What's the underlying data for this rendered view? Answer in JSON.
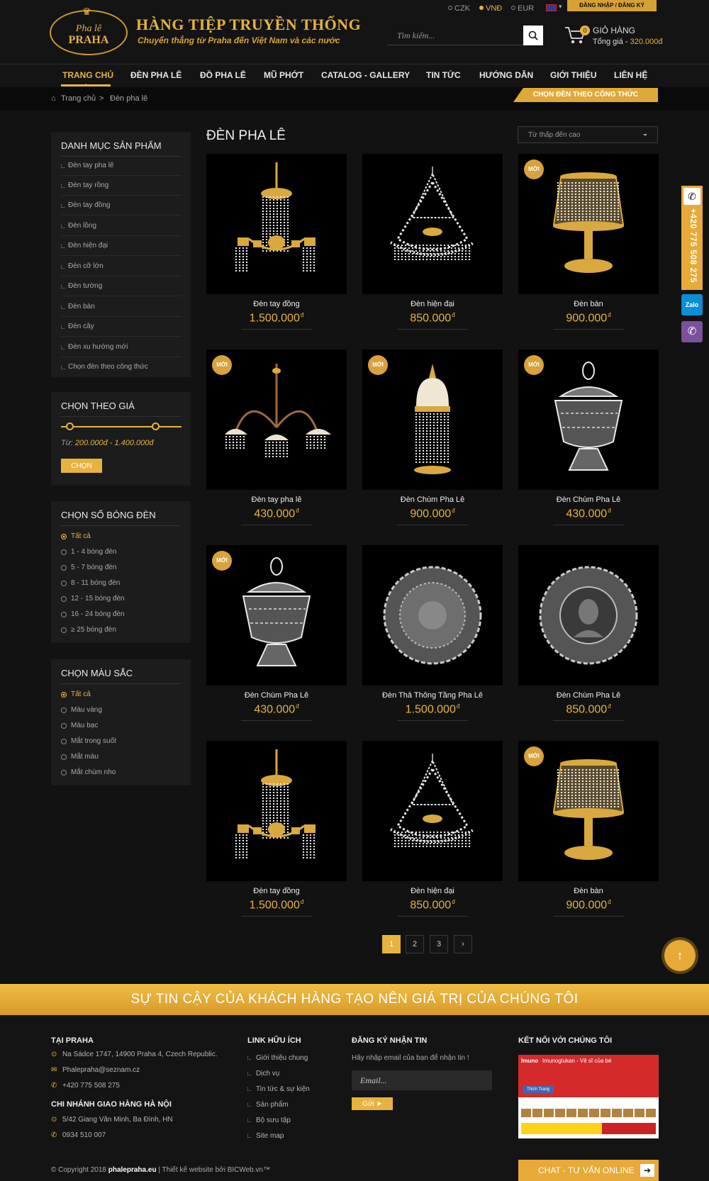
{
  "header": {
    "logo_line1": "Pha lê",
    "logo_line2": "PRAHA",
    "title": "HÀNG TIỆP TRUYỀN THỐNG",
    "subtitle": "Chuyển thẳng từ Praha đến Việt Nam và các nước",
    "currencies": [
      "CZK",
      "VNĐ",
      "EUR"
    ],
    "selected_currency": "VNĐ",
    "login_label": "ĐĂNG NHẬP / ĐĂNG KÝ",
    "search_placeholder": "Tìm kiếm...",
    "cart_count": "0",
    "cart_title": "GIỎ HÀNG",
    "cart_total_label": "Tổng giá - ",
    "cart_total_value": "320.000đ"
  },
  "nav": {
    "items": [
      "TRANG CHỦ",
      "ĐÈN PHA LÊ",
      "ĐỒ PHA LÊ",
      "MŨ PHỚT",
      "CATALOG - GALLERY",
      "TIN TỨC",
      "HƯỚNG DẪN",
      "GIỚI THIỆU",
      "LIÊN HỆ"
    ],
    "active": "TRANG CHỦ"
  },
  "breadcrumb": {
    "home": "Trang chủ",
    "sep": ">",
    "current": "Đèn pha lê",
    "formula_tab": "CHỌN ĐÈN THEO CÔNG THỨC"
  },
  "sidebar": {
    "categories_title": "DANH MỤC SẢN PHẨM",
    "categories": [
      "Đèn tay pha lê",
      "Đèn tay rồng",
      "Đèn tay đồng",
      "Đèn lồng",
      "Đèn hiện đại",
      "Đèn cỡ lớn",
      "Đèn tường",
      "Đèn bàn",
      "Đèn cây",
      "Đèn xu hướng mới",
      "Chọn đèn theo công thức"
    ],
    "price_title": "CHỌN THEO GIÁ",
    "price_prefix": "Từ: ",
    "price_range": "200.000đ - 1.400.000đ",
    "price_min_fraction": 0.07,
    "price_max_fraction": 0.78,
    "price_button": "CHỌN",
    "bulbs_title": "CHỌN SỐ BÓNG ĐÈN",
    "bulbs": [
      "Tất cả",
      "1 - 4 bóng đèn",
      "5 - 7 bóng đèn",
      "8 - 11 bóng đèn",
      "12 - 15 bóng đèn",
      "16 - 24 bóng đèn",
      "≥ 25 bóng đèn"
    ],
    "colors_title": "CHỌN MÀU SẮC",
    "colors": [
      "Tất cả",
      "Màu vàng",
      "Màu bạc",
      "Mắt trong suốt",
      "Mắt màu",
      "Mắt chùm nho"
    ]
  },
  "main": {
    "heading": "ĐÈN PHA LÊ",
    "sort_value": "Từ thấp đến cao",
    "new_badge": "MỚI",
    "currency_symbol": "đ",
    "products": [
      {
        "name": "Đèn tay đồng",
        "price": "1.500.000",
        "is_new": false,
        "image": "gold-chandelier"
      },
      {
        "name": "Đèn hiện đại",
        "price": "850.000",
        "is_new": false,
        "image": "crystal-tier"
      },
      {
        "name": "Đèn bàn",
        "price": "900.000",
        "is_new": true,
        "image": "table-lamp"
      },
      {
        "name": "Đèn tay pha lê",
        "price": "430.000",
        "is_new": true,
        "image": "bronze-arms"
      },
      {
        "name": "Đèn Chùm Pha Lê",
        "price": "900.000",
        "is_new": true,
        "image": "tower-lamp"
      },
      {
        "name": "Đèn Chùm Pha Lê",
        "price": "430.000",
        "is_new": true,
        "image": "crystal-bowl"
      },
      {
        "name": "Đèn Chùm Pha Lê",
        "price": "430.000",
        "is_new": true,
        "image": "crystal-bowl"
      },
      {
        "name": "Đèn Thả Thông Tầng Pha Lê",
        "price": "1.500.000",
        "is_new": false,
        "image": "crystal-plate"
      },
      {
        "name": "Đèn Chùm Pha Lê",
        "price": "850.000",
        "is_new": false,
        "image": "portrait-plate"
      },
      {
        "name": "Đèn tay đồng",
        "price": "1.500.000",
        "is_new": false,
        "image": "gold-chandelier"
      },
      {
        "name": "Đèn hiện đại",
        "price": "850.000",
        "is_new": false,
        "image": "crystal-tier"
      },
      {
        "name": "Đèn bàn",
        "price": "900.000",
        "is_new": true,
        "image": "table-lamp"
      }
    ],
    "pagination": [
      "1",
      "2",
      "3",
      "›"
    ],
    "current_page": "1"
  },
  "contact_float": {
    "phone": "+420 775 508 275",
    "zalo": "Zalo"
  },
  "banner": "SỰ TIN CẬY CỦA KHÁCH HÀNG TẠO NÊN GIÁ TRỊ CỦA CHÚNG TÔI",
  "footer": {
    "praha_title": "TẠI PRAHA",
    "praha_address": "Na Sádce 1747, 14900 Praha 4, Czech Republic.",
    "praha_email": "Phalepraha@seznam.cz",
    "praha_phone": "+420 775 508 275",
    "hanoi_title": "CHI NHÁNH GIAO HÀNG HÀ NỘI",
    "hanoi_address": "5/42 Giang Văn Minh, Ba Đình, HN",
    "hanoi_phone": "0934 510 007",
    "links_title": "LINK HỮU ÍCH",
    "links": [
      "Giới thiệu chung",
      "Dịch vụ",
      "Tin tức & sự kiện",
      "Sản phẩm",
      "Bộ sưu tập",
      "Site map"
    ],
    "newsletter_title": "ĐĂNG KÝ NHẬN TIN",
    "newsletter_desc": "Hãy nhập email của bạn để nhận tin !",
    "email_placeholder": "Email...",
    "send_label": "Gửi ➤",
    "social_title": "KẾT NỐI VỚI CHÚNG TÔI",
    "fb_page_name": "Imunoglukan - Vệ sĩ của bé",
    "fb_like": "Thích Trang",
    "copyright_prefix": "© Copyright 2018 ",
    "copyright_site": "phalepraha.eu",
    "copyright_suffix": " | Thiết kế website bởi BICWeb.vn™",
    "chat_label": "CHAT - TƯ VẤN ONLINE"
  },
  "colors": {
    "accent": "#e7b33e",
    "background": "#121212",
    "panel": "#1c1c1c"
  }
}
